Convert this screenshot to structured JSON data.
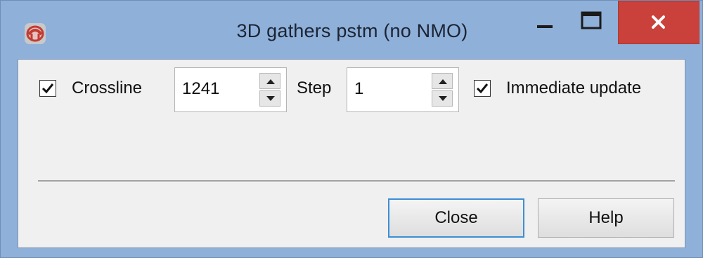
{
  "window": {
    "title": "3D gathers pstm (no NMO)",
    "controls": {
      "minimize_icon": "minimize-icon",
      "maximize_icon": "maximize-icon",
      "close_icon": "close-icon",
      "close_color": "#c9413a"
    }
  },
  "toolbar": {
    "crossline_label": "Crossline",
    "crossline_checked": true,
    "crossline_value": "1241",
    "step_label": "Step",
    "step_value": "1",
    "immediate_update_label": "Immediate update",
    "immediate_update_checked": true
  },
  "footer": {
    "close_label": "Close",
    "help_label": "Help"
  },
  "colors": {
    "titlebar": "#8fb0d9",
    "client": "#f0f0f0",
    "focus_border": "#3c8ed7"
  }
}
